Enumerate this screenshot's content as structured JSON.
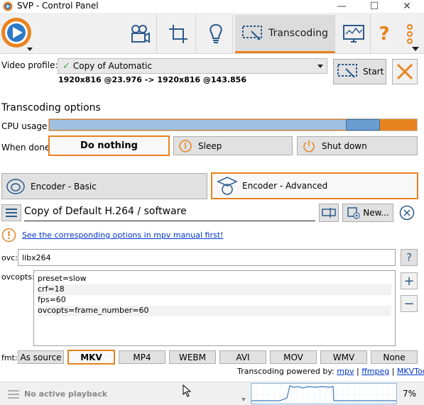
{
  "window": {
    "title": "SVP - Control Panel",
    "minimize": "—",
    "maximize": "☐",
    "close": "✕"
  },
  "toolbar": {
    "tabs": [
      {
        "name": "video-camera"
      },
      {
        "name": "crop"
      },
      {
        "name": "lightbulb"
      },
      {
        "name": "transcoding",
        "label": "Transcoding",
        "active": true
      },
      {
        "name": "monitor"
      },
      {
        "name": "help",
        "label": "?"
      },
      {
        "name": "menu"
      }
    ]
  },
  "profile": {
    "label": "Video profile:",
    "value": "Copy of Automatic",
    "info": "1920x816 @23.976 -> 1920x816 @143.856",
    "start": "Start"
  },
  "options": {
    "heading": "Transcoding options",
    "cpu_label": "CPU usage",
    "when_done_label": "When done",
    "do_nothing": "Do nothing",
    "sleep": "Sleep",
    "shutdown": "Shut down",
    "cpu_level": 0.89
  },
  "encoder": {
    "basic": "Encoder - Basic",
    "advanced": "Encoder - Advanced",
    "preset_name": "Copy of Default H.264 / software",
    "new_label": "New...",
    "manual_link": "See the corresponding options in mpv manual first!"
  },
  "fields": {
    "ovc_label": "ovc:",
    "ovc_value": "libx264",
    "ovcopts_label": "ovcopts:",
    "ovcopts_lines": [
      "preset=slow",
      "crf=18",
      "fps=60",
      "ovcopts=frame_number=60"
    ],
    "help": "?",
    "plus": "+",
    "minus": "−"
  },
  "format": {
    "label": "fmt:",
    "as_source": "As source",
    "options": [
      "MKV",
      "MP4",
      "WEBM",
      "AVI",
      "MOV",
      "WMV",
      "None"
    ],
    "selected": "MKV"
  },
  "powered": {
    "prefix": "Transcoding powered by:",
    "mpv": "mpv",
    "sep1": "|",
    "ffmpeg": "ffmpeg",
    "sep2": "|",
    "mkvtoolnix": "MKVToolNix"
  },
  "status": {
    "text": "No active playback",
    "cpu_percent": "7%"
  },
  "colors": {
    "accent": "#e8821e",
    "link": "#0033cc",
    "cpu_bar": "#8ab4dc"
  }
}
